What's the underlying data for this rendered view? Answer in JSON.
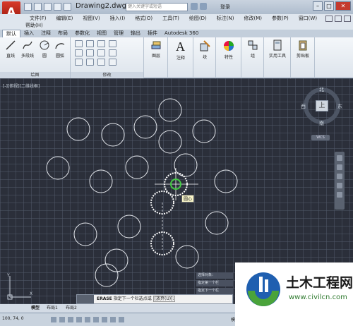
{
  "title_bar": {
    "app_logo": "A",
    "doc_title": "Drawing2.dwg",
    "search_placeholder": "键入关键字或短语",
    "login": "登录"
  },
  "menu": {
    "items": [
      "文件(F)",
      "编辑(E)",
      "视图(V)",
      "插入(I)",
      "格式(O)",
      "工具(T)",
      "绘图(D)",
      "标注(N)",
      "修改(M)",
      "参数(P)",
      "窗口(W)"
    ],
    "second_row": "帮助(H)"
  },
  "ribbon_tabs": [
    "默认",
    "插入",
    "注释",
    "布局",
    "参数化",
    "视图",
    "管理",
    "输出",
    "插件",
    "Autodesk 360"
  ],
  "ribbon": {
    "draw_tools": [
      "直线",
      "多段线",
      "圆",
      "圆弧"
    ],
    "draw_group": "绘图",
    "modify_group": "修改",
    "layers": "图层",
    "annotate": "注释",
    "block": "块",
    "properties": "特性",
    "group": "组",
    "utilities": "实用工具",
    "clipboard": "剪贴板"
  },
  "viewport_label": "[-][俯视][二维线框]",
  "viewcube": {
    "top": "上",
    "north": "北",
    "south": "南",
    "east": "东",
    "west": "西",
    "wcs": "WCS"
  },
  "tooltip": "圆心",
  "command_history": [
    "选择对象：",
    "指定第一个栏",
    "指定下一个栏"
  ],
  "command_line": {
    "command": "ERASE",
    "prompt": "指定下一个栏选点或",
    "option": "[放弃(U)]:"
  },
  "layout_tabs": [
    "模型",
    "布局1",
    "布局2"
  ],
  "status": {
    "coords": "100, 74, 0",
    "model": "模型"
  },
  "watermark": {
    "title": "土木工程网",
    "url": "www.civilcn.com"
  },
  "colors": {
    "canvas_bg": "#2b2f3a",
    "circle_stroke": "#e6e9ee",
    "selected_stroke": "#ffffff",
    "snap_marker": "#44cc44",
    "app_red": "#c8281a"
  }
}
